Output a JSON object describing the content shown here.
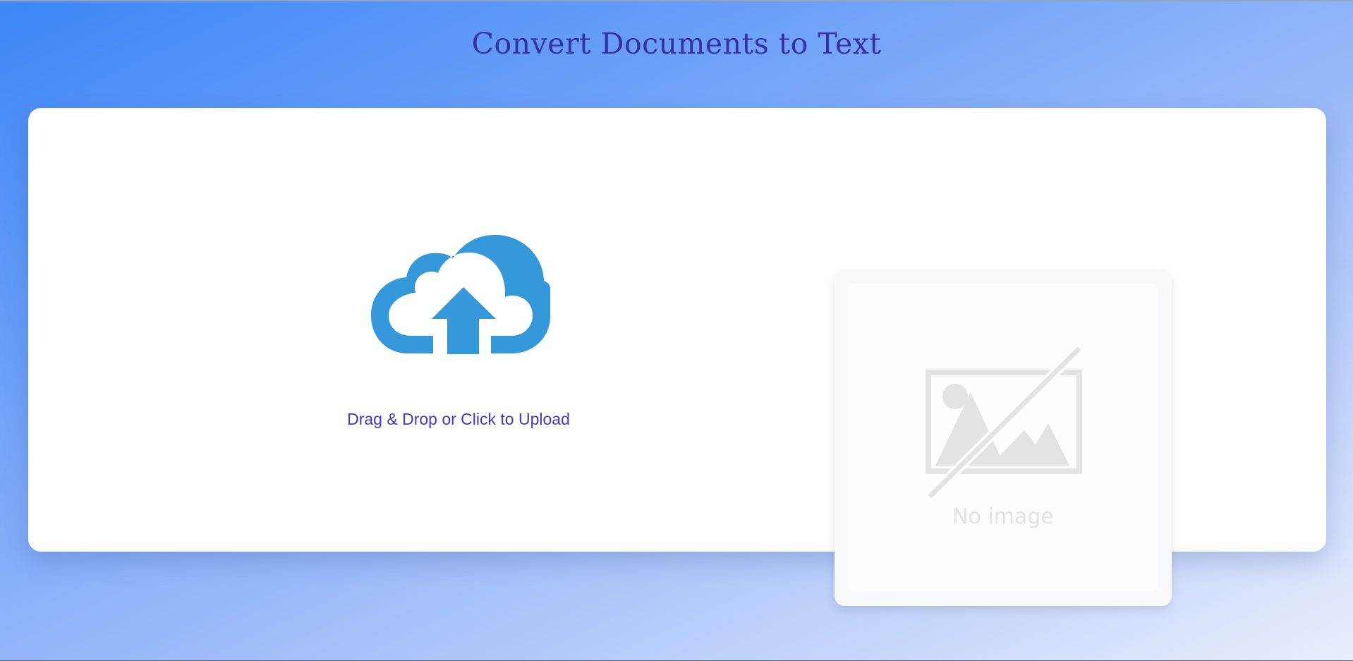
{
  "header": {
    "title": "Convert Documents to Text"
  },
  "upload": {
    "label": "Drag & Drop or Click to Upload",
    "icon": "cloud-upload-icon"
  },
  "preview": {
    "placeholder_text": "No image",
    "icon": "no-image-icon"
  },
  "colors": {
    "title": "#3730a3",
    "upload_label": "#4338ca",
    "cloud_icon": "#3498db",
    "placeholder": "#e2e3e3"
  }
}
